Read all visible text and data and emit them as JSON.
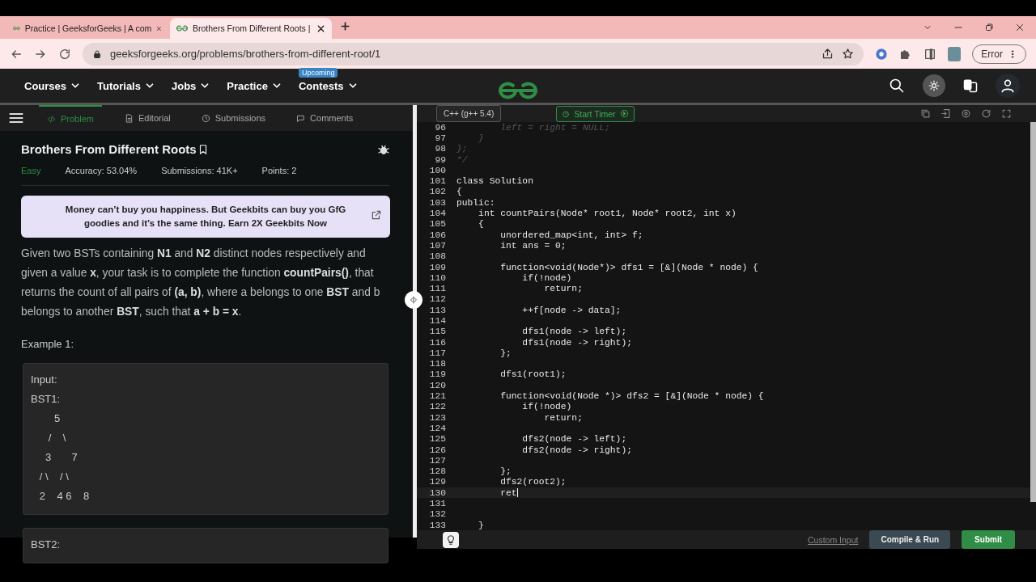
{
  "browser": {
    "tabs": [
      {
        "title": "Practice | GeeksforGeeks | A com",
        "selected": false
      },
      {
        "title": "Brothers From Different Roots | ",
        "selected": true
      }
    ],
    "address": "geeksforgeeks.org/problems/brothers-from-different-root/1",
    "profile_button": "Error"
  },
  "site_nav": {
    "items": [
      {
        "label": "Courses"
      },
      {
        "label": "Tutorials"
      },
      {
        "label": "Jobs"
      },
      {
        "label": "Practice"
      },
      {
        "label": "Contests",
        "badge": "Upcoming"
      }
    ]
  },
  "problem_tabs": [
    {
      "label": "Problem",
      "selected": true
    },
    {
      "label": "Editorial",
      "selected": false
    },
    {
      "label": "Submissions",
      "selected": false
    },
    {
      "label": "Comments",
      "selected": false
    }
  ],
  "problem": {
    "title": "Brothers From Different Roots",
    "difficulty": "Easy",
    "accuracy": "Accuracy: 53.04%",
    "submissions": "Submissions: 41K+",
    "points": "Points: 2",
    "banner": "Money can’t buy you happiness. But Geekbits can buy you GfG goodies and it’s the same thing. Earn 2X Geekbits Now",
    "description": "Given two BSTs containing **N1** and **N2** distinct nodes respectively and given a value **x**, your task is to complete the function **countPairs()**, that returns the count of all pairs of **(a, b)**, where a belongs to one **BST** and b belongs to another **BST**, such that **a + b = x**.",
    "example_title": "Example 1:",
    "example_boxes": [
      {
        "lines": [
          "Input:",
          "BST1:",
          "        5",
          "      /    \\",
          "     3       7",
          "   / \\    / \\",
          "   2    4 6    8"
        ]
      },
      {
        "lines": [
          "BST2:"
        ]
      }
    ]
  },
  "editor": {
    "language": "C++ (g++ 5.4)",
    "timer_button": "Start Timer",
    "lines": [
      {
        "number": "96",
        "text": "        left = right = NULL;",
        "kind": "comment",
        "active": false
      },
      {
        "number": "97",
        "text": "    }",
        "kind": "comment",
        "active": false
      },
      {
        "number": "98",
        "text": "};",
        "kind": "comment",
        "active": false
      },
      {
        "number": "99",
        "text": "*/",
        "kind": "comment",
        "active": false
      },
      {
        "number": "100",
        "active": false
      },
      {
        "number": "101",
        "text": "class Solution",
        "kind": "code",
        "active": false
      },
      {
        "number": "102",
        "text": "{",
        "kind": "code",
        "active": false
      },
      {
        "number": "103",
        "text": "public:",
        "kind": "code",
        "active": false
      },
      {
        "number": "104",
        "text": "    int countPairs(Node* root1, Node* root2, int x)",
        "kind": "code",
        "active": false
      },
      {
        "number": "105",
        "text": "    {",
        "kind": "code",
        "active": false
      },
      {
        "number": "106",
        "text": "        unordered_map<int, int> f;",
        "kind": "code",
        "active": false
      },
      {
        "number": "107",
        "text": "        int ans = 0;",
        "kind": "code",
        "active": false
      },
      {
        "number": "108",
        "active": false
      },
      {
        "number": "109",
        "text": "        function<void(Node*)> dfs1 = [&](Node * node) {",
        "kind": "code",
        "active": false
      },
      {
        "number": "110",
        "text": "            if(!node)",
        "kind": "code",
        "active": false
      },
      {
        "number": "111",
        "text": "                return;",
        "kind": "code",
        "active": false
      },
      {
        "number": "112",
        "active": false
      },
      {
        "number": "113",
        "text": "            ++f[node -> data];",
        "kind": "code",
        "active": false
      },
      {
        "number": "114",
        "active": false
      },
      {
        "number": "115",
        "text": "            dfs1(node -> left);",
        "kind": "code",
        "active": false
      },
      {
        "number": "116",
        "text": "            dfs1(node -> right);",
        "kind": "code",
        "active": false
      },
      {
        "number": "117",
        "text": "        };",
        "kind": "code",
        "active": false
      },
      {
        "number": "118",
        "active": false
      },
      {
        "number": "119",
        "text": "        dfs1(root1);",
        "kind": "code",
        "active": false
      },
      {
        "number": "120",
        "active": false
      },
      {
        "number": "121",
        "text": "        function<void(Node *)> dfs2 = [&](Node * node) {",
        "kind": "code",
        "active": false
      },
      {
        "number": "122",
        "text": "            if(!node)",
        "kind": "code",
        "active": false
      },
      {
        "number": "123",
        "text": "                return;",
        "kind": "code",
        "active": false
      },
      {
        "number": "124",
        "active": false
      },
      {
        "number": "125",
        "text": "            dfs2(node -> left);",
        "kind": "code",
        "active": false
      },
      {
        "number": "126",
        "text": "            dfs2(node -> right);",
        "kind": "code",
        "active": false
      },
      {
        "number": "127",
        "active": false
      },
      {
        "number": "128",
        "text": "        };",
        "kind": "code",
        "active": false
      },
      {
        "number": "129",
        "text": "        dfs2(root2);",
        "kind": "code",
        "active": false
      },
      {
        "number": "130",
        "text": "        ret",
        "kind": "code",
        "active": true
      },
      {
        "number": "131",
        "active": false
      },
      {
        "number": "132",
        "active": false
      },
      {
        "number": "133",
        "text": "    }",
        "kind": "code",
        "active": false
      }
    ],
    "custom_input": "Custom Input",
    "compile_button": "Compile & Run",
    "submit_button": "Submit"
  }
}
